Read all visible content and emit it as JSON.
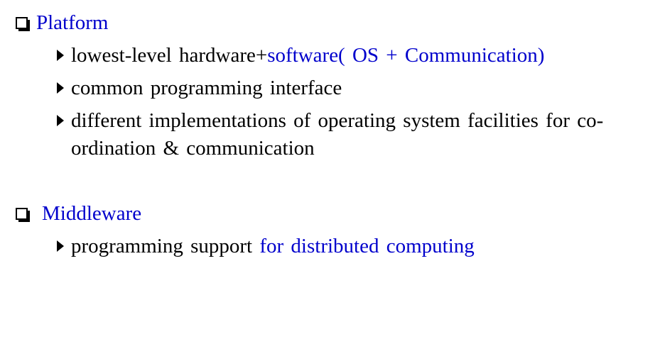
{
  "sections": [
    {
      "title": "Platform",
      "bullets": [
        {
          "parts": [
            "lowest-level hardware+",
            "software( OS + Communication)"
          ]
        },
        {
          "parts": [
            "common programming interface"
          ]
        },
        {
          "parts": [
            "different implementations of operating system facilities for co-",
            "ordination & communication"
          ]
        }
      ]
    },
    {
      "title": "Middleware",
      "bullets": [
        {
          "parts": [
            "programming support ",
            "for distributed computing"
          ]
        }
      ]
    }
  ],
  "colors": {
    "accent": "#0000cc",
    "text": "#000000",
    "background": "#ffffff"
  },
  "icons": {
    "section_marker": "checkbox-square-icon",
    "bullet_marker": "triangle-right-icon"
  }
}
